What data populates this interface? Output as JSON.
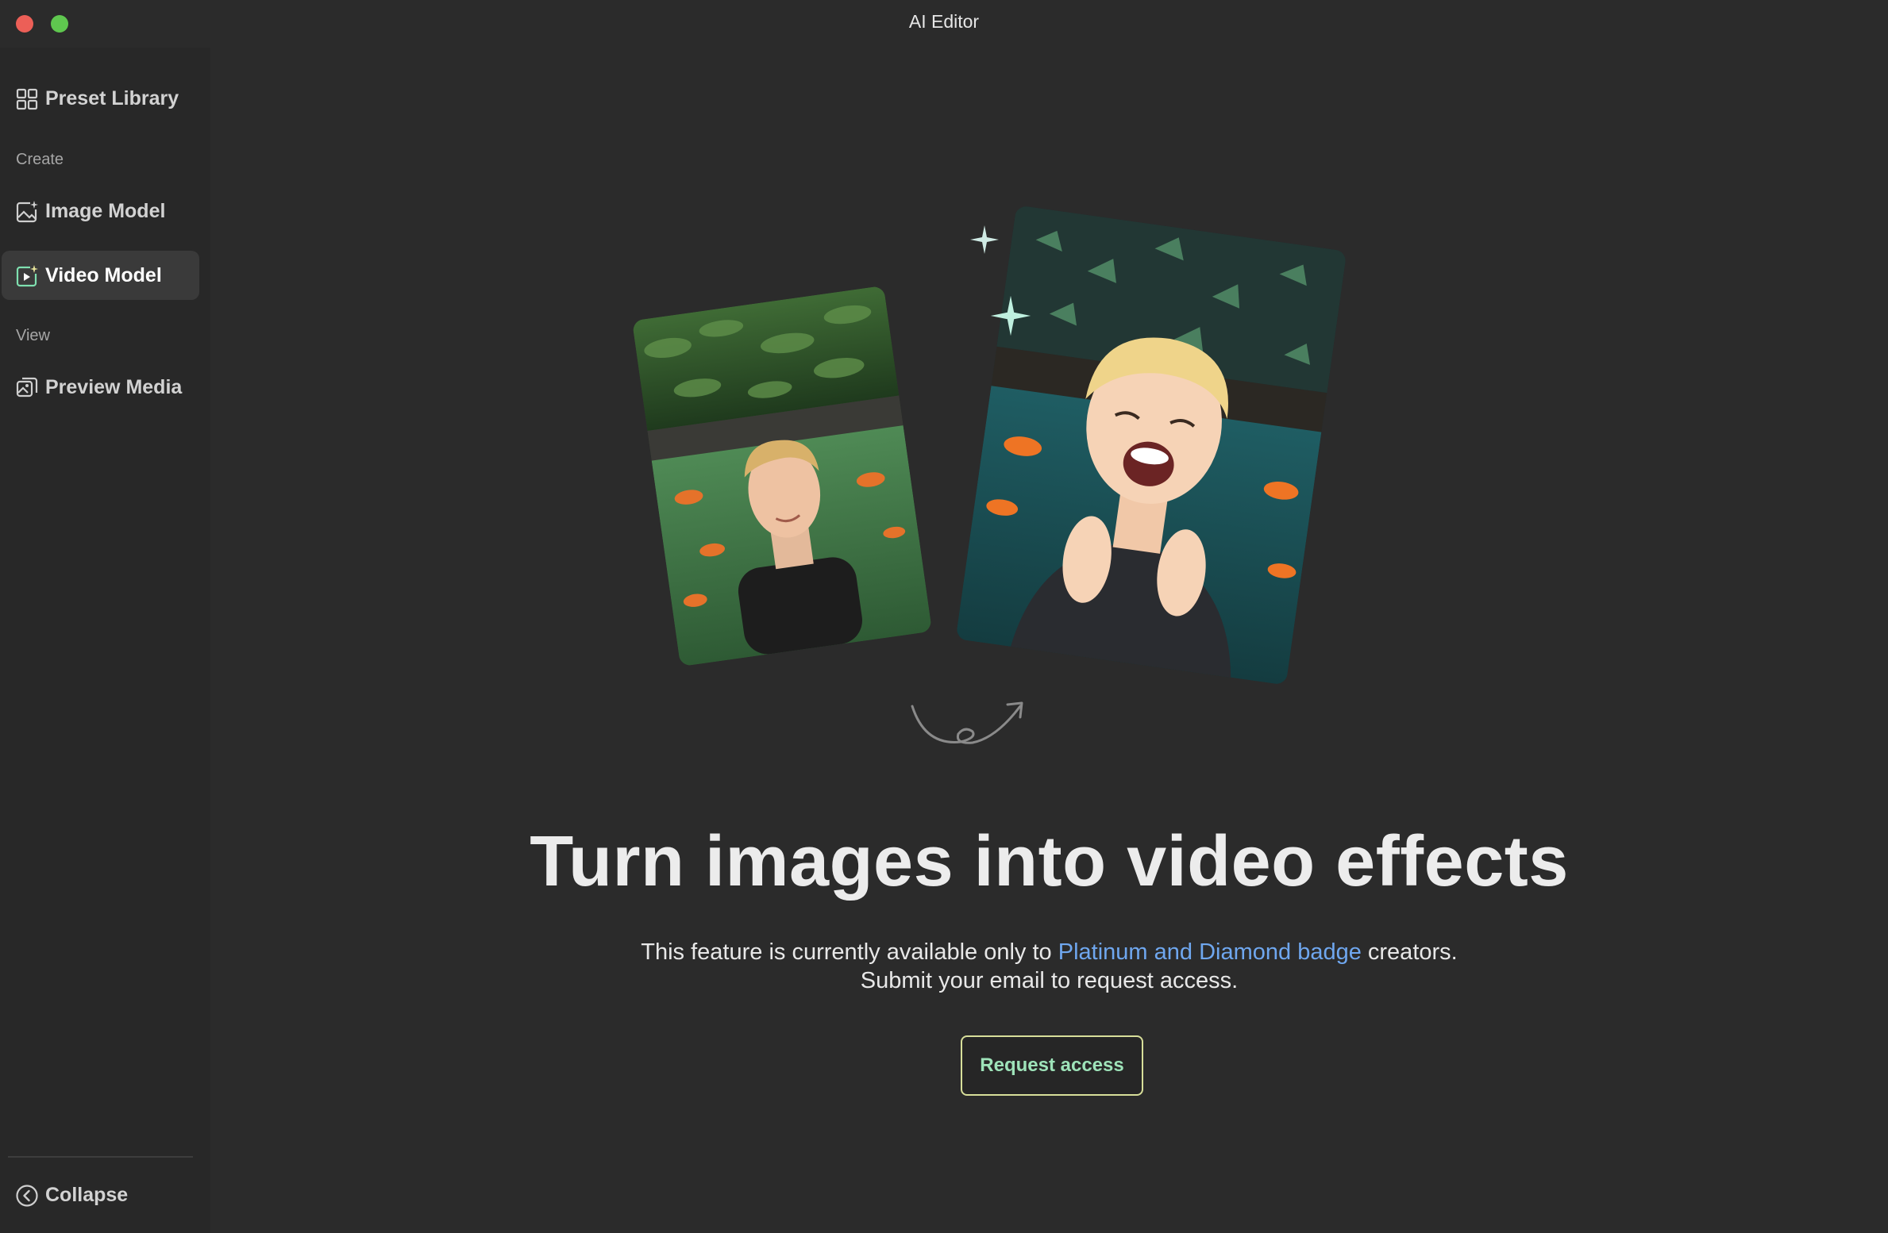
{
  "window": {
    "title": "AI Editor"
  },
  "sidebar": {
    "items": [
      {
        "label": "Preset Library",
        "icon": "grid-icon"
      },
      {
        "section": "Create"
      },
      {
        "label": "Image Model",
        "icon": "image-sparkle-icon"
      },
      {
        "label": "Video Model",
        "icon": "video-sparkle-icon",
        "active": true
      },
      {
        "section": "View"
      },
      {
        "label": "Preview Media",
        "icon": "media-preview-icon"
      }
    ],
    "collapse_label": "Collapse"
  },
  "main": {
    "headline": "Turn images into video effects",
    "description_pre": "This feature is currently available only to ",
    "description_link": "Platinum and Diamond badge",
    "description_post": " creators.",
    "description_line2": "Submit your email to request access.",
    "button_label": "Request access"
  },
  "colors": {
    "link": "#6fa7ef",
    "button_border": "#d8df9a",
    "button_text": "#9ee3b9",
    "active_item_bg": "#3a3a3a"
  }
}
